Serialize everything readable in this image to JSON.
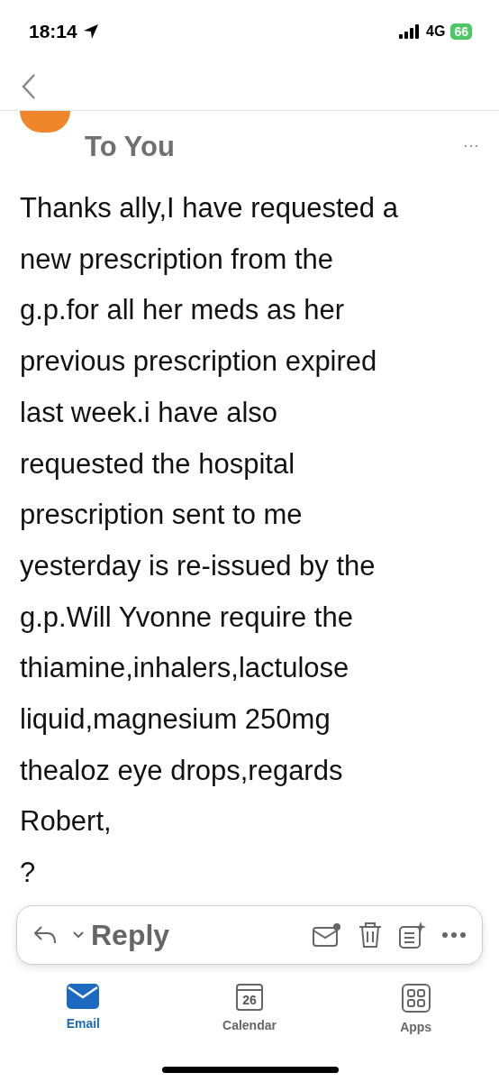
{
  "status_bar": {
    "time": "18:14",
    "network": "4G",
    "battery": "66"
  },
  "message": {
    "recipient": "To You",
    "more": "···",
    "body_lines": [
      "Thanks ally,I have requested a",
      "new prescription from the",
      "g.p.for all her meds as her",
      "previous prescription expired",
      "last week.i have also",
      "requested the hospital",
      "prescription sent to me",
      "yesterday is re-issued by the",
      "g.p.Will Yvonne require the",
      "thiamine,inhalers,lactulose",
      "liquid,magnesium 250mg",
      "thealoz eye drops,regards",
      "Robert,",
      "?"
    ]
  },
  "reply_bar": {
    "label": "Reply"
  },
  "tabs": [
    {
      "label": "Email",
      "kind": "email",
      "selected": true
    },
    {
      "label": "Calendar",
      "kind": "calendar",
      "icon_text": "26",
      "selected": false
    },
    {
      "label": "Apps",
      "kind": "apps",
      "selected": false
    }
  ]
}
